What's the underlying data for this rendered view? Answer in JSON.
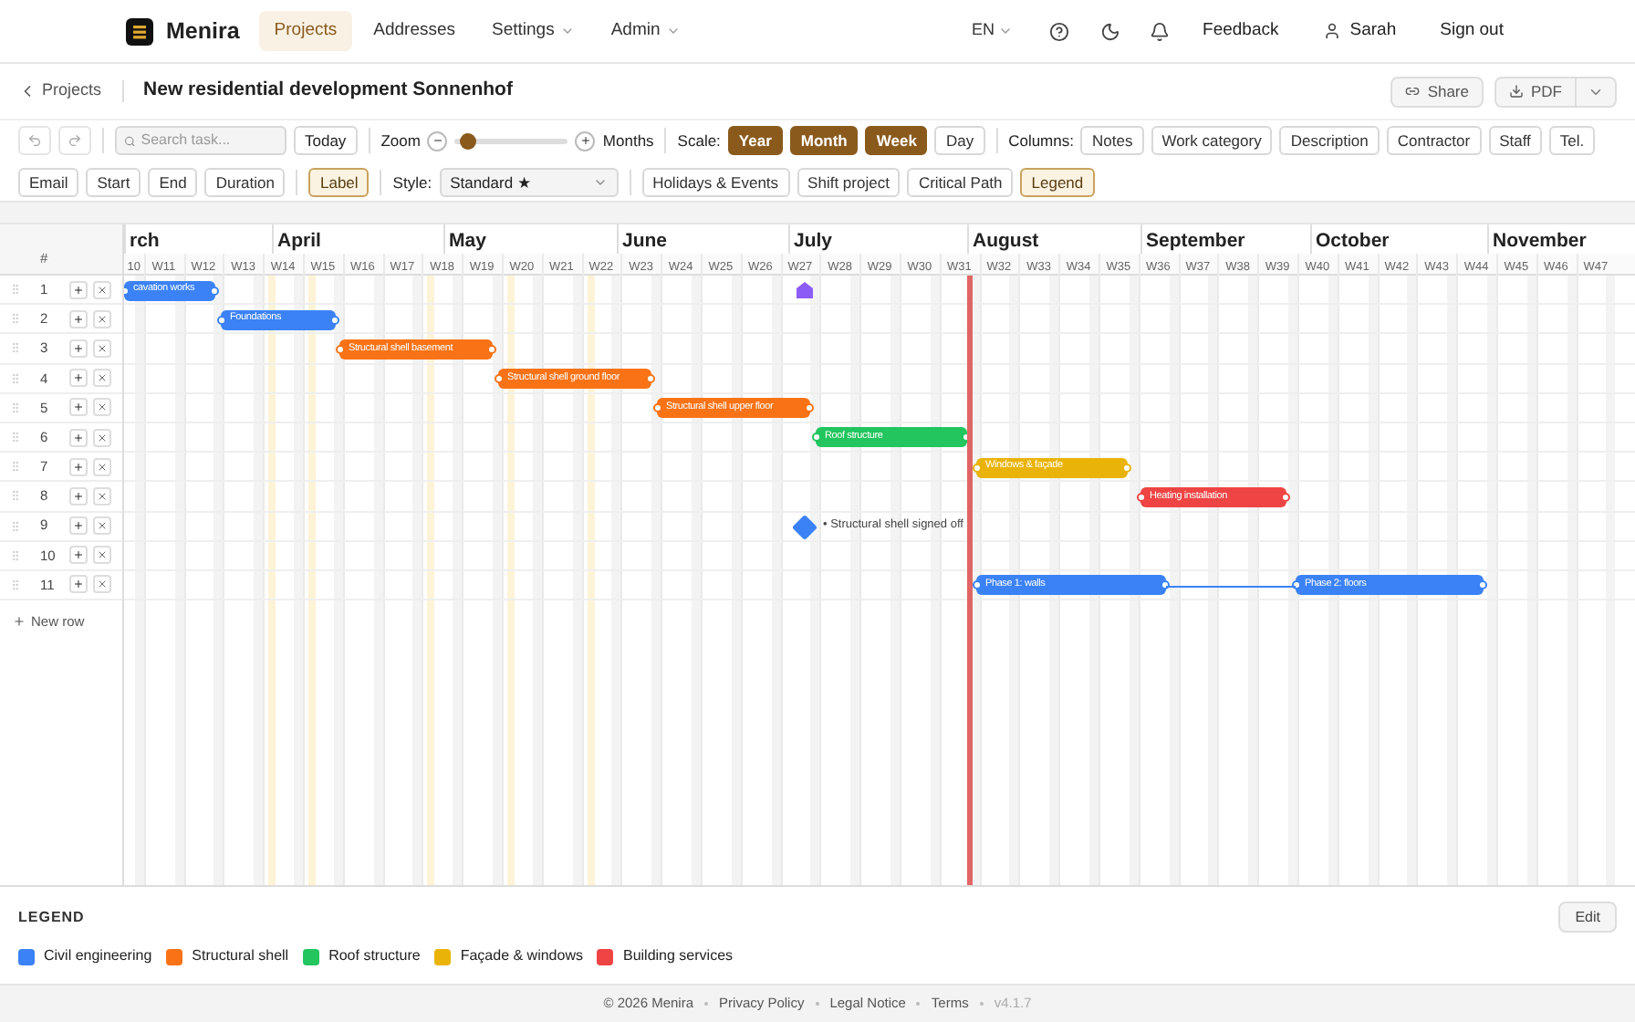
{
  "app": {
    "name": "Menira"
  },
  "nav": [
    {
      "label": "Projects",
      "selected": true,
      "dropdown": false
    },
    {
      "label": "Addresses",
      "selected": false,
      "dropdown": false
    },
    {
      "label": "Settings",
      "selected": false,
      "dropdown": true
    },
    {
      "label": "Admin",
      "selected": false,
      "dropdown": true
    }
  ],
  "header_right": {
    "language": "EN",
    "feedback": "Feedback",
    "user": "Sarah",
    "sign_out": "Sign out"
  },
  "breadcrumb": {
    "back": "Projects",
    "title": "New residential development Sonnenhof"
  },
  "actions": {
    "share": "Share",
    "pdf": "PDF"
  },
  "toolbar": {
    "search_placeholder": "Search task...",
    "today": "Today",
    "zoom_label": "Zoom",
    "zoom": {
      "level": 0.05
    },
    "zoom_unit": "Months",
    "scale_label": "Scale:",
    "scales": [
      {
        "label": "Year",
        "selected": true
      },
      {
        "label": "Month",
        "selected": true
      },
      {
        "label": "Week",
        "selected": true
      },
      {
        "label": "Day",
        "selected": false
      }
    ],
    "columns_label": "Columns:",
    "columns": [
      {
        "label": "Notes",
        "selected": false
      },
      {
        "label": "Work category",
        "selected": false
      },
      {
        "label": "Description",
        "selected": false
      },
      {
        "label": "Contractor",
        "selected": false
      },
      {
        "label": "Staff",
        "selected": false
      },
      {
        "label": "Tel.",
        "selected": false
      },
      {
        "label": "Email",
        "selected": false
      },
      {
        "label": "Start",
        "selected": false
      },
      {
        "label": "End",
        "selected": false
      },
      {
        "label": "Duration",
        "selected": false
      }
    ],
    "label_toggle": {
      "label": "Label",
      "selected": true
    },
    "style_label": "Style:",
    "style_value": "Standard ★",
    "options": [
      {
        "label": "Holidays & Events",
        "selected": false
      },
      {
        "label": "Shift project",
        "selected": false
      },
      {
        "label": "Critical Path",
        "selected": false
      },
      {
        "label": "Legend",
        "selected": true
      }
    ]
  },
  "gantt": {
    "number_header": "#",
    "months": [
      "rch",
      "April",
      "May",
      "June",
      "July",
      "August",
      "September",
      "October",
      "November"
    ],
    "weeks": [
      "10",
      "W11",
      "W12",
      "W13",
      "W14",
      "W15",
      "W16",
      "W17",
      "W18",
      "W19",
      "W20",
      "W21",
      "W22",
      "W23",
      "W24",
      "W25",
      "W26",
      "W27",
      "W28",
      "W29",
      "W30",
      "W31",
      "W32",
      "W33",
      "W34",
      "W35",
      "W36",
      "W37",
      "W38",
      "W39",
      "W40",
      "W41",
      "W42",
      "W43",
      "W44",
      "W45",
      "W46",
      "W47"
    ],
    "rows": [
      {
        "number": "1",
        "items": [
          {
            "kind": "bar",
            "label": "cavation works",
            "color": "#3b82f6"
          },
          {
            "kind": "marker",
            "color": "#8b5cf6"
          }
        ]
      },
      {
        "number": "2",
        "items": [
          {
            "kind": "bar",
            "label": "Foundations",
            "color": "#3b82f6"
          }
        ]
      },
      {
        "number": "3",
        "items": [
          {
            "kind": "bar",
            "label": "Structural shell basement",
            "color": "#f97316"
          }
        ]
      },
      {
        "number": "4",
        "items": [
          {
            "kind": "bar",
            "label": "Structural shell ground floor",
            "color": "#f97316"
          }
        ]
      },
      {
        "number": "5",
        "items": [
          {
            "kind": "bar",
            "label": "Structural shell upper floor",
            "color": "#f97316"
          }
        ]
      },
      {
        "number": "6",
        "items": [
          {
            "kind": "bar",
            "label": "Roof structure",
            "color": "#22c55e"
          }
        ]
      },
      {
        "number": "7",
        "items": [
          {
            "kind": "bar",
            "label": "Windows & façade",
            "color": "#eab308"
          }
        ]
      },
      {
        "number": "8",
        "items": [
          {
            "kind": "bar",
            "label": "Heating installation",
            "color": "#ef4444"
          }
        ]
      },
      {
        "number": "9",
        "items": [
          {
            "kind": "milestone",
            "label": "• Structural shell signed off",
            "color": "#3b82f6"
          }
        ]
      },
      {
        "number": "10"
      },
      {
        "number": "11",
        "items": [
          {
            "kind": "bar",
            "label": "Phase 1: walls",
            "color": "#3b82f6"
          },
          {
            "kind": "bar",
            "label": "Phase 2: floors",
            "color": "#3b82f6"
          }
        ]
      }
    ],
    "new_row": "New row"
  },
  "legend": {
    "title": "LEGEND",
    "edit": "Edit",
    "items": [
      {
        "label": "Civil engineering",
        "color": "#3b82f6"
      },
      {
        "label": "Structural shell",
        "color": "#f97316"
      },
      {
        "label": "Roof structure",
        "color": "#22c55e"
      },
      {
        "label": "Façade & windows",
        "color": "#eab308"
      },
      {
        "label": "Building services",
        "color": "#ef4444"
      }
    ]
  },
  "footer": {
    "copyright": "© 2026 Menira",
    "links": [
      "Privacy Policy",
      "Legal Notice",
      "Terms"
    ],
    "version": "v4.1.7"
  }
}
